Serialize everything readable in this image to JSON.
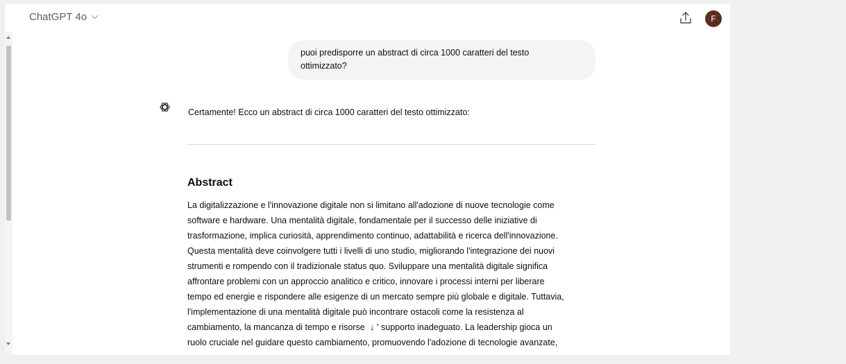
{
  "header": {
    "model_name": "ChatGPT 4o",
    "avatar_initial": "F"
  },
  "conversation": {
    "user_message_lines": [
      "puoi predisporre un abstract di circa 1000 caratteri del testo",
      "ottimizzato?"
    ],
    "assistant_intro": "Certamente! Ecco un abstract di circa 1000 caratteri del testo ottimizzato:",
    "abstract_heading": "Abstract",
    "abstract_lines": [
      "La digitalizzazione e l'innovazione digitale non si limitano all'adozione di nuove tecnologie come",
      "software e hardware. Una mentalità digitale, fondamentale per il successo delle iniziative di",
      "trasformazione, implica curiosità, apprendimento continuo, adattabilità e ricerca dell'innovazione.",
      "Questa mentalità deve coinvolgere tutti i livelli di uno studio, migliorando l'integrazione dei nuovi",
      "strumenti e rompendo con il tradizionale status quo. Sviluppare una mentalità digitale significa",
      "affrontare problemi con un approccio analitico e critico, innovare i processi interni per liberare",
      "tempo ed energie e rispondere alle esigenze di un mercato sempre più globale e digitale. Tuttavia,",
      "l'implementazione di una mentalità digitale può incontrare ostacoli come la resistenza al",
      "ruolo cruciale nel guidare questo cambiamento, promuovendo l'adozione di tecnologie avanzate,"
    ],
    "abstract_line_with_overlay": {
      "before": "cambiamento, la mancanza di tempo e risorse ",
      "arrow": "↓",
      "after": "' supporto inadeguato. La leadership gioca un"
    }
  },
  "icons": {
    "model_dropdown": "chevron-down-icon",
    "share": "share-icon",
    "assistant": "openai-logo-icon",
    "scroll_down": "arrow-down-icon"
  },
  "colors": {
    "avatar_bg": "#5c2d1e",
    "user_bubble_bg": "#f4f4f4",
    "page_bg": "#ffffff"
  }
}
